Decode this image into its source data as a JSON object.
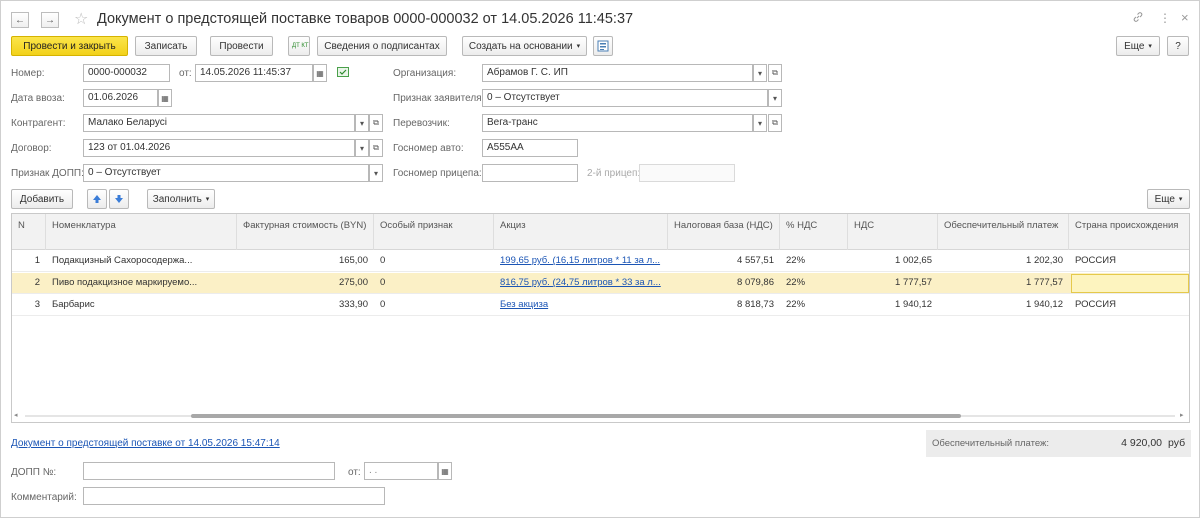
{
  "window": {
    "title": "Документ о предстоящей поставке товаров 0000-000032 от 14.05.2026 11:45:37",
    "nav_back": "←",
    "nav_forward": "→",
    "star": "☆",
    "link_icon": "🔗",
    "more_icon": "⋮",
    "close_icon": "×"
  },
  "toolbar": {
    "post_close": "Провести и закрыть",
    "save": "Записать",
    "post": "Провести",
    "dt_kt": "ДТ КТ",
    "signers": "Сведения о подписантах",
    "create_based": "Создать на основании",
    "more": "Еще",
    "help": "?"
  },
  "form": {
    "number_label": "Номер:",
    "number": "0000-000032",
    "from_label": "от:",
    "date": "14.05.2026 11:45:37",
    "import_date_label": "Дата ввоза:",
    "import_date": "01.06.2026",
    "contractor_label": "Контрагент:",
    "contractor": "Малако Беларусі",
    "contract_label": "Договор:",
    "contract": "123 от 01.04.2026",
    "dopp_sign_label": "Признак ДОПП:",
    "dopp_sign": "0 – Отсутствует",
    "org_label": "Организация:",
    "org": "Абрамов Г. С. ИП",
    "applicant_label": "Признак заявителя:",
    "applicant": "0 – Отсутствует",
    "carrier_label": "Перевозчик:",
    "carrier": "Вега-транс",
    "auto_label": "Госномер авто:",
    "auto": "А555АА",
    "trailer_label": "Госномер прицепа:",
    "trailer": "",
    "trailer2_label": "2-й прицеп:",
    "trailer2": ""
  },
  "table_toolbar": {
    "add": "Добавить",
    "fill": "Заполнить",
    "more": "Еще"
  },
  "table": {
    "columns": [
      "N",
      "Номенклатура",
      "Фактурная стоимость (BYN)",
      "Особый признак",
      "Акциз",
      "Налоговая база (НДС)",
      "% НДС",
      "НДС",
      "Обеспечительный платеж",
      "Страна происхождения"
    ],
    "rows": [
      {
        "n": "1",
        "name": "Подакцизный Сахоросодержа...",
        "cost": "165,00",
        "special": "0",
        "excise": "199,65 руб. (16,15 литров * 11 за л...",
        "base": "4 557,51",
        "vat_pct": "22%",
        "vat": "1 002,65",
        "deposit": "1 202,30",
        "country": "РОССИЯ"
      },
      {
        "n": "2",
        "name": "Пиво подакцизное маркируемо...",
        "cost": "275,00",
        "special": "0",
        "excise": "816,75 руб. (24,75 литров * 33 за л...",
        "base": "8 079,86",
        "vat_pct": "22%",
        "vat": "1 777,57",
        "deposit": "1 777,57",
        "country": ""
      },
      {
        "n": "3",
        "name": "Барбарис",
        "cost": "333,90",
        "special": "0",
        "excise": "Без акциза",
        "base": "8 818,73",
        "vat_pct": "22%",
        "vat": "1 940,12",
        "deposit": "1 940,12",
        "country": "РОССИЯ"
      }
    ]
  },
  "footer": {
    "doc_link": "Документ о предстоящей поставке от 14.05.2026 15:47:14",
    "deposit_label": "Обеспечительный платеж:",
    "deposit_value": "4 920,00",
    "currency": "руб",
    "dopp_no_label": "ДОПП №:",
    "dopp_no": "",
    "dopp_from_label": "от:",
    "dopp_date": " .  .",
    "comment_label": "Комментарий:",
    "comment": ""
  }
}
